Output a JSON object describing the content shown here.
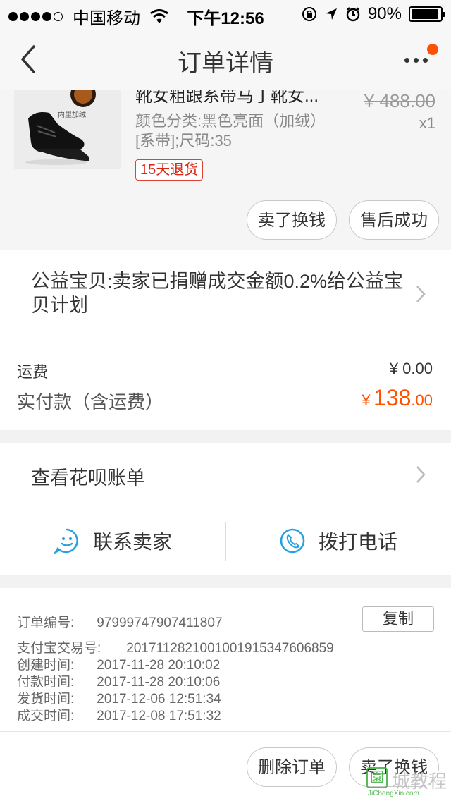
{
  "status_bar": {
    "carrier": "中国移动",
    "time": "下午12:56",
    "battery": "90%"
  },
  "nav": {
    "title": "订单详情"
  },
  "product": {
    "title": "靴女粗跟系带马丁靴女...",
    "original_price": "¥ 488.00",
    "spec": "颜色分类:黑色亮面（加绒）[系带];尺码:35",
    "quantity": "x1",
    "image_tag": "内里加绒",
    "refund_tag": "15天退货",
    "buttons": {
      "sell": "卖了换钱",
      "aftersale": "售后成功"
    }
  },
  "charity": {
    "text": "公益宝贝:卖家已捐赠成交金额0.2%给公益宝贝计划"
  },
  "totals": {
    "shipping_label": "运费",
    "shipping_value": "¥ 0.00",
    "paid_label": "实付款（含运费）",
    "paid_currency": "¥",
    "paid_integer": "138",
    "paid_decimal": ".00"
  },
  "huabei": {
    "text": "查看花呗账单"
  },
  "contact": {
    "seller": "联系卖家",
    "phone": "拨打电话"
  },
  "order_info": {
    "order_no_label": "订单编号:",
    "order_no": "97999747907411807",
    "copy_label": "复制",
    "alipay_label": "支付宝交易号:",
    "alipay_no": "2017112821001001915347606859",
    "created_label": "创建时间:",
    "created": "2017-11-28 20:10:02",
    "paid_label": "付款时间:",
    "paid": "2017-11-28 20:10:06",
    "shipped_label": "发货时间:",
    "shipped": "2017-12-06 12:51:34",
    "done_label": "成交时间:",
    "done": "2017-12-08 17:51:32"
  },
  "bottom": {
    "delete": "删除订单",
    "sell": "卖了换钱"
  },
  "watermark": {
    "text": "城教程",
    "url": "JiChengXin.com"
  },
  "colors": {
    "accent": "#ff5000",
    "icon_blue": "#29a1e0",
    "refund_red": "#d21"
  }
}
